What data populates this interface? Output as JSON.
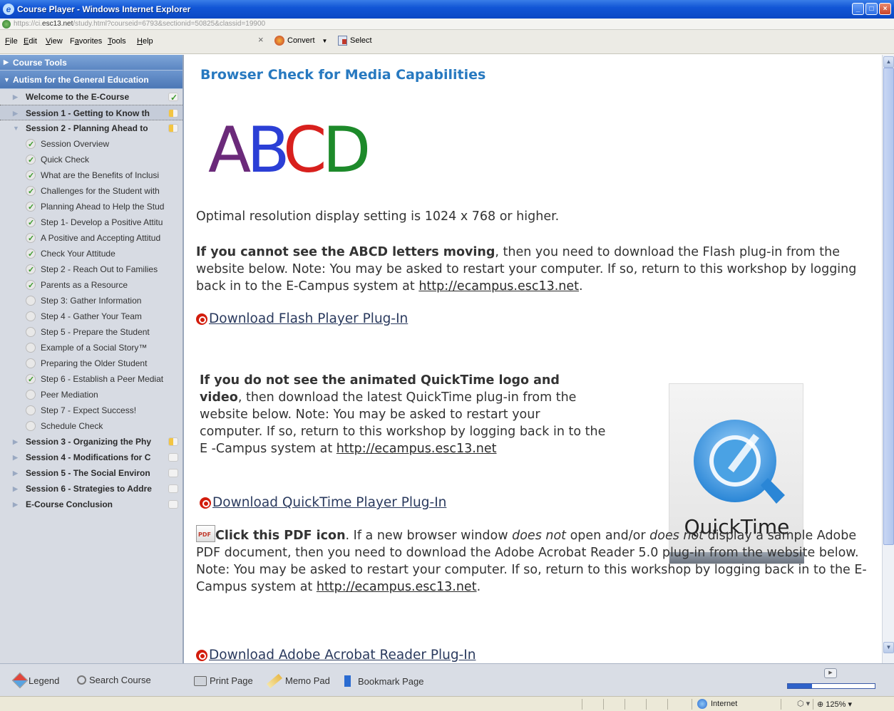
{
  "window": {
    "title": "Course Player - Windows Internet Explorer",
    "url_prefix": "https://ci.",
    "url_host": "esc13.net",
    "url_rest": "/study.html?courseid=6793&sectionid=50825&classid=19900"
  },
  "menu": [
    "File",
    "Edit",
    "View",
    "Favorites",
    "Tools",
    "Help"
  ],
  "menu_accel": [
    "F",
    "E",
    "V",
    "a",
    "T",
    "H"
  ],
  "toolbar": {
    "close": "×",
    "convert": "Convert",
    "select": "Select"
  },
  "sidebar": {
    "course_tools": "Course Tools",
    "course_title": "Autism for the General Education",
    "items": [
      {
        "label": "Welcome to the E-Course",
        "kind": "session",
        "status": "ok",
        "expanded": false,
        "selected": false
      },
      {
        "label": "Session 1 - Getting to Know th",
        "kind": "session",
        "status": "half",
        "expanded": false,
        "selected": true
      },
      {
        "label": "Session 2 - Planning Ahead to",
        "kind": "session",
        "status": "half",
        "expanded": true,
        "selected": false
      },
      {
        "label": "Session Overview",
        "kind": "page",
        "done": true
      },
      {
        "label": "Quick Check",
        "kind": "page",
        "done": true
      },
      {
        "label": "What are the Benefits of Inclusi",
        "kind": "page",
        "done": true
      },
      {
        "label": "Challenges for the Student with",
        "kind": "page",
        "done": true
      },
      {
        "label": "Planning Ahead to Help the Stud",
        "kind": "page",
        "done": true
      },
      {
        "label": "Step 1- Develop a Positive Attitu",
        "kind": "page",
        "done": true
      },
      {
        "label": "A Positive and Accepting Attitud",
        "kind": "page",
        "done": true
      },
      {
        "label": "Check Your Attitude",
        "kind": "page",
        "done": true
      },
      {
        "label": "Step 2 - Reach Out to Families",
        "kind": "page",
        "done": true
      },
      {
        "label": "Parents as a Resource",
        "kind": "page",
        "done": true
      },
      {
        "label": "Step 3: Gather Information",
        "kind": "page",
        "done": false
      },
      {
        "label": "Step 4 - Gather Your Team",
        "kind": "page",
        "done": false
      },
      {
        "label": "Step 5 - Prepare the Student",
        "kind": "page",
        "done": false
      },
      {
        "label": "Example of a Social Story™",
        "kind": "page",
        "done": false
      },
      {
        "label": "Preparing the Older Student",
        "kind": "page",
        "done": false
      },
      {
        "label": "Step 6 - Establish a Peer Mediat",
        "kind": "page",
        "done": true
      },
      {
        "label": "Peer Mediation",
        "kind": "page",
        "done": false
      },
      {
        "label": "Step 7 - Expect Success!",
        "kind": "page",
        "done": false
      },
      {
        "label": "Schedule Check",
        "kind": "page",
        "done": false
      },
      {
        "label": "Session 3 - Organizing the Phy",
        "kind": "session",
        "status": "half",
        "expanded": false,
        "selected": false
      },
      {
        "label": "Session 4 - Modifications for C",
        "kind": "session",
        "status": "none",
        "expanded": false,
        "selected": false
      },
      {
        "label": "Session 5 - The Social Environ",
        "kind": "session",
        "status": "none",
        "expanded": false,
        "selected": false
      },
      {
        "label": "Session 6 - Strategies to Addre",
        "kind": "session",
        "status": "none",
        "expanded": false,
        "selected": false
      },
      {
        "label": "E-Course Conclusion",
        "kind": "session",
        "status": "none",
        "expanded": false,
        "selected": false
      }
    ],
    "legend": "Legend",
    "search": "Search Course"
  },
  "content": {
    "heading": "Browser Check for Media Capabilities",
    "abcd": "ABCD",
    "resolution": "Optimal resolution display setting is 1024 x 768 or higher.",
    "flash_bold": "If you cannot see the ABCD letters moving",
    "flash_text": ", then you need to download the Flash plug-in from the website below. Note: You may be asked to restart your computer. If so, return to this workshop by logging back in to the E-Campus system at ",
    "ecampus_link": "http://ecampus.esc13.net",
    "period": ".",
    "flash_download": "Download Flash Player Plug-In",
    "qt_bold": "If you do not see the animated QuickTime logo and video",
    "qt_text": ", then download the latest QuickTime plug-in from the website below. Note: You may be asked to restart your computer. If so, return to this workshop by logging back in to the E -Campus system at ",
    "qt_download": "Download QuickTime Player Plug-In",
    "qt_logo_text": "QuickTime",
    "pdf_icon_text": "PDF",
    "pdf_bold": "Click this PDF icon",
    "pdf_text1": ". If a new browser window ",
    "pdf_em1": "does not",
    "pdf_text2": " open and/or ",
    "pdf_em2": "does not",
    "pdf_text3": " display a sample Adobe PDF document, then you need to download the Adobe Acrobat Reader 5.0 plug-in from the website below. Note: You may be asked to restart your computer. If so, return to this workshop by logging back in to the E-Campus system at ",
    "acrobat_download": "Download Adobe Acrobat Reader Plug-In"
  },
  "footer": {
    "print": "Print Page",
    "memo": "Memo Pad",
    "bookmark": "Bookmark Page",
    "progress": 0.28
  },
  "status": {
    "zone": "Internet",
    "zoom": "125%"
  },
  "colors": {
    "heading": "#2779c0",
    "sidebar_bg": "#d7dbe3",
    "title_bar": "#1256d6"
  }
}
